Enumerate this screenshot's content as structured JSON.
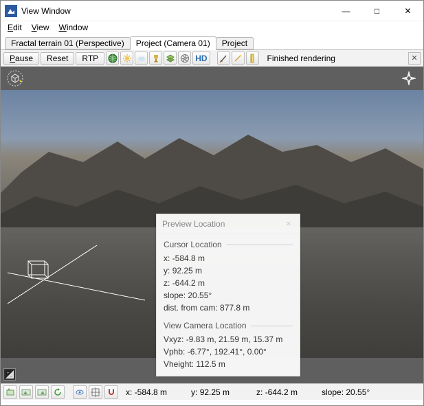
{
  "window": {
    "title": "View Window"
  },
  "menubar": {
    "edit": "Edit",
    "view": "View",
    "window": "Window"
  },
  "tabs": [
    {
      "label": "Fractal terrain 01 (Perspective)",
      "active": false
    },
    {
      "label": "Project (Camera 01)",
      "active": true
    },
    {
      "label": "Project",
      "active": false
    }
  ],
  "toolbar": {
    "pause_label": "Pause",
    "reset_label": "Reset",
    "rtp_label": "RTP",
    "hd_label": "HD",
    "status_text": "Finished rendering"
  },
  "panel": {
    "title": "Preview Location",
    "cursor_section": "Cursor Location",
    "x_label": "x:",
    "x_value": "-584.8 m",
    "y_label": "y:",
    "y_value": "92.25 m",
    "z_label": "z:",
    "z_value": "-644.2 m",
    "slope_label": "slope:",
    "slope_value": "20.55°",
    "dist_label": "dist. from cam:",
    "dist_value": "877.8 m",
    "camera_section": "View Camera Location",
    "vxyz_label": "Vxyz:",
    "vxyz_value": "-9.83 m, 21.59 m, 15.37 m",
    "vphb_label": "Vphb:",
    "vphb_value": "-6.77°, 192.41°, 0.00°",
    "vheight_label": "Vheight:",
    "vheight_value": "112.5 m"
  },
  "statusbar": {
    "x_label": "x:",
    "x_value": "-584.8 m",
    "y_label": "y:",
    "y_value": "92.25 m",
    "z_label": "z:",
    "z_value": "-644.2 m",
    "slope_label": "slope:",
    "slope_value": "20.55°"
  }
}
